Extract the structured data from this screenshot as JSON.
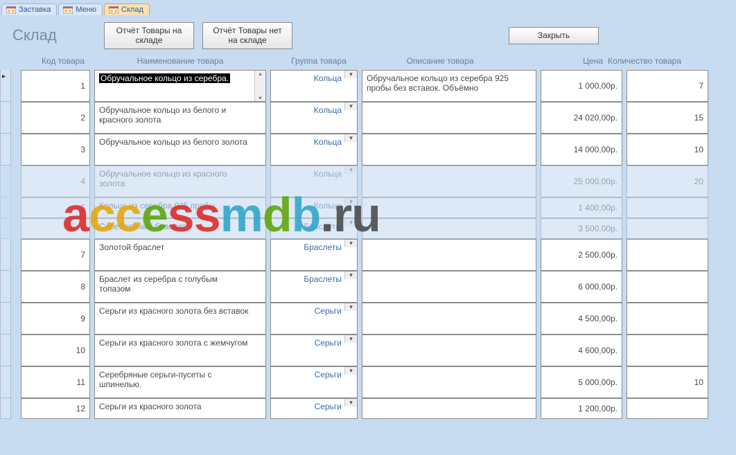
{
  "tabs": [
    {
      "label": "Заставка",
      "active": false
    },
    {
      "label": "Меню",
      "active": false
    },
    {
      "label": "Склад",
      "active": true
    }
  ],
  "form": {
    "title": "Склад",
    "buttons": {
      "report_in": "Отчёт Товары на складе",
      "report_out": "Отчёт Товары нет на складе",
      "close": "Закрыть"
    }
  },
  "columns": {
    "code": "Код товара",
    "name": "Наименование товара",
    "group": "Группа товара",
    "desc": "Описание товара",
    "price": "Цена",
    "qty": "Количество товара"
  },
  "rows": [
    {
      "code": "1",
      "name": "Обручальное кольцо из серебра.",
      "group": "Кольца",
      "desc": "Обручальное кольцо из серебра 925 пробы без вставок. Объёмно",
      "price": "1 000,00р.",
      "qty": "7",
      "selected_name": true,
      "has_scroll": true
    },
    {
      "code": "2",
      "name": "Обручальное кольцо из белого и красного золота",
      "group": "Кольца",
      "desc": "",
      "price": "24 020,00р.",
      "qty": "15"
    },
    {
      "code": "3",
      "name": "Обручальное кольцо из белого золота",
      "group": "Кольца",
      "desc": "",
      "price": "14 000,00р.",
      "qty": "10"
    },
    {
      "code": "4",
      "name": "Обручальное кольцо из красного золота",
      "group": "Кольца",
      "desc": "",
      "price": "25 000,00р.",
      "qty": "20",
      "faded": true
    },
    {
      "code": "5",
      "name": "Кольцо из серебра 925 пробы",
      "group": "Кольца",
      "desc": "",
      "price": "1 400,00р.",
      "qty": "",
      "faded": true,
      "short": true
    },
    {
      "code": "6",
      "name": "Серебрянный браслет",
      "group": "Браслеты",
      "desc": "",
      "price": "3 500,00р.",
      "qty": "",
      "faded": true,
      "short": true
    },
    {
      "code": "7",
      "name": "Золотой браслет",
      "group": "Браслеты",
      "desc": "",
      "price": "2 500,00р.",
      "qty": ""
    },
    {
      "code": "8",
      "name": "Браслет из серебра с голубым топазом",
      "group": "Браслеты",
      "desc": "",
      "price": "6 000,00р.",
      "qty": ""
    },
    {
      "code": "9",
      "name": "Серьги из красного золота без вставок",
      "group": "Серьги",
      "desc": "",
      "price": "4 500,00р.",
      "qty": ""
    },
    {
      "code": "10",
      "name": "Серьги из красного золота с жемчугом",
      "group": "Серьги",
      "desc": "",
      "price": "4 600,00р.",
      "qty": ""
    },
    {
      "code": "11",
      "name": "Серебряные серьги-пусеты с шпинелью.",
      "group": "Серьги",
      "desc": "",
      "price": "5 000,00р.",
      "qty": "10"
    },
    {
      "code": "12",
      "name": "Серьги из красного золота",
      "group": "Серьги",
      "desc": "",
      "price": "1 200,00р.",
      "qty": "",
      "short": true
    }
  ],
  "watermark": "accessmdb.ru"
}
